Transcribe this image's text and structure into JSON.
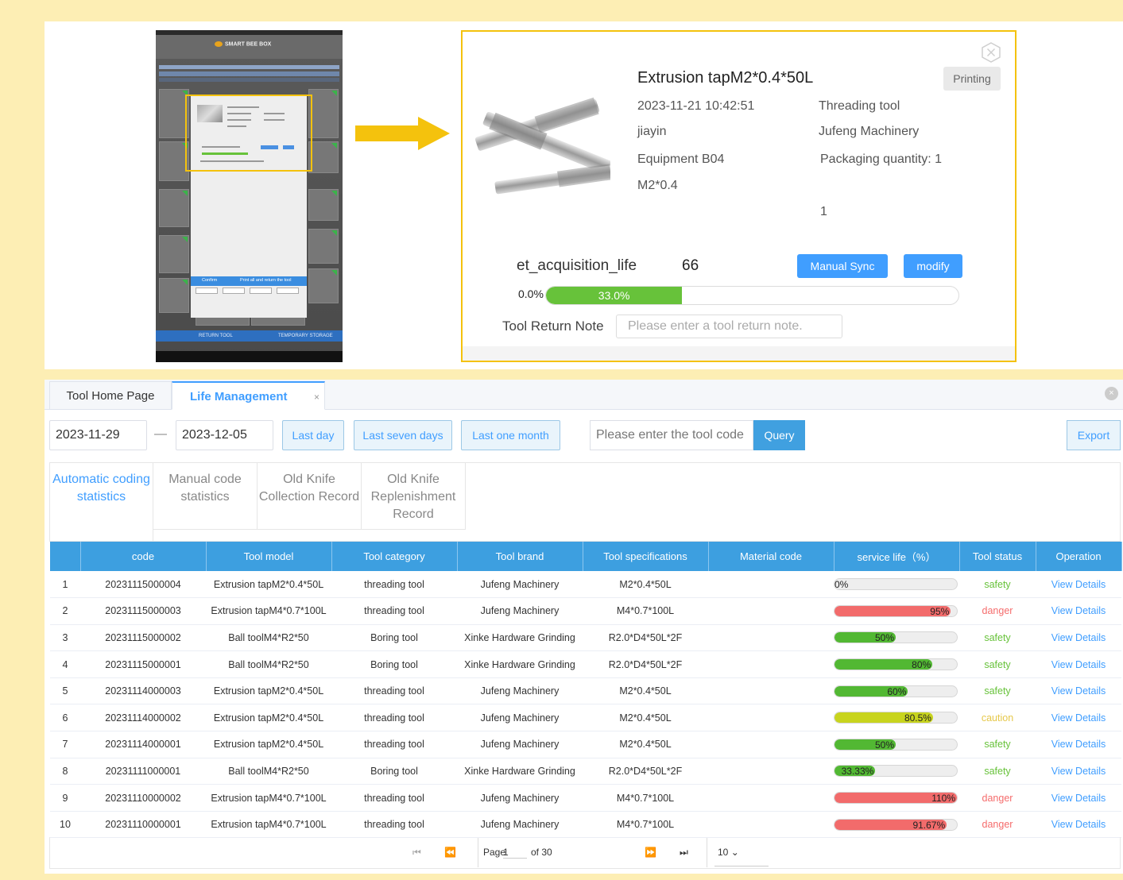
{
  "phone": {
    "logo": "SMART BEE BOX",
    "confirm": "Confirm",
    "print_all": "Print all and return the tool",
    "return_tool": "RETURN TOOL",
    "temporary_storage": "TEMPORARY STORAGE"
  },
  "detail": {
    "title": "Extrusion tapM2*0.4*50L",
    "printing": "Printing",
    "time": "2023-11-21 10:42:51",
    "category": "Threading tool",
    "user": "jiayin",
    "brand": "Jufeng Machinery",
    "equipment": "Equipment B04",
    "packaging": "Packaging quantity: 1",
    "spec": "M2*0.4",
    "count": "1",
    "life_label": "et_acquisition_life",
    "life_value": "66",
    "manual_sync": "Manual Sync",
    "modify": "modify",
    "bar_start": "0.0%",
    "progress_label": "33.0%",
    "progress": 33.0,
    "return_note_label": "Tool Return Note",
    "return_note_placeholder": "Please enter a tool return note."
  },
  "tabs": {
    "home": "Tool Home Page",
    "life": "Life Management",
    "close": "×"
  },
  "filters": {
    "start_date": "2023-11-29",
    "dash": "—",
    "end_date": "2023-12-05",
    "last_day": "Last day",
    "last_seven": "Last seven days",
    "last_month": "Last one month",
    "code_placeholder": "Please enter the tool code",
    "query": "Query",
    "export": "Export"
  },
  "subtabs": {
    "auto": "Automatic coding statistics",
    "manual": "Manual code statistics",
    "old_collection": "Old Knife Collection Record",
    "old_replenish": "Old Knife Replenishment Record"
  },
  "table": {
    "headers": [
      "",
      "code",
      "Tool model",
      "Tool category",
      "Tool brand",
      "Tool specifications",
      "Material code",
      "service life（%）",
      "Tool status",
      "Operation"
    ],
    "rows": [
      {
        "no": "1",
        "code": "20231115000004",
        "model": "Extrusion tapM2*0.4*50L",
        "category": "threading tool",
        "brand": "Jufeng Machinery",
        "spec": "M2*0.4*50L",
        "material": "",
        "life": 0,
        "life_label": "0%",
        "status": "safety",
        "op": "View Details"
      },
      {
        "no": "2",
        "code": "20231115000003",
        "model": "Extrusion tapM4*0.7*100L",
        "category": "threading tool",
        "brand": "Jufeng Machinery",
        "spec": "M4*0.7*100L",
        "material": "",
        "life": 95,
        "life_label": "95%",
        "status": "danger",
        "op": "View Details"
      },
      {
        "no": "3",
        "code": "20231115000002",
        "model": "Ball toolM4*R2*50",
        "category": "Boring tool",
        "brand": "Xinke Hardware Grinding",
        "spec": "R2.0*D4*50L*2F",
        "material": "",
        "life": 50,
        "life_label": "50%",
        "status": "safety",
        "op": "View Details"
      },
      {
        "no": "4",
        "code": "20231115000001",
        "model": "Ball toolM4*R2*50",
        "category": "Boring tool",
        "brand": "Xinke Hardware Grinding",
        "spec": "R2.0*D4*50L*2F",
        "material": "",
        "life": 80,
        "life_label": "80%",
        "status": "safety",
        "op": "View Details"
      },
      {
        "no": "5",
        "code": "20231114000003",
        "model": "Extrusion tapM2*0.4*50L",
        "category": "threading tool",
        "brand": "Jufeng Machinery",
        "spec": "M2*0.4*50L",
        "material": "",
        "life": 60,
        "life_label": "60%",
        "status": "safety",
        "op": "View Details"
      },
      {
        "no": "6",
        "code": "20231114000002",
        "model": "Extrusion tapM2*0.4*50L",
        "category": "threading tool",
        "brand": "Jufeng Machinery",
        "spec": "M2*0.4*50L",
        "material": "",
        "life": 80.5,
        "life_label": "80.5%",
        "status": "caution",
        "op": "View Details"
      },
      {
        "no": "7",
        "code": "20231114000001",
        "model": "Extrusion tapM2*0.4*50L",
        "category": "threading tool",
        "brand": "Jufeng Machinery",
        "spec": "M2*0.4*50L",
        "material": "",
        "life": 50,
        "life_label": "50%",
        "status": "safety",
        "op": "View Details"
      },
      {
        "no": "8",
        "code": "20231111000001",
        "model": "Ball toolM4*R2*50",
        "category": "Boring tool",
        "brand": "Xinke Hardware Grinding",
        "spec": "R2.0*D4*50L*2F",
        "material": "",
        "life": 33.33,
        "life_label": "33.33%",
        "status": "safety",
        "op": "View Details"
      },
      {
        "no": "9",
        "code": "20231110000002",
        "model": "Extrusion tapM4*0.7*100L",
        "category": "threading tool",
        "brand": "Jufeng Machinery",
        "spec": "M4*0.7*100L",
        "material": "",
        "life": 110,
        "life_label": "110%",
        "status": "danger",
        "op": "View Details"
      },
      {
        "no": "10",
        "code": "20231110000001",
        "model": "Extrusion tapM4*0.7*100L",
        "category": "threading tool",
        "brand": "Jufeng Machinery",
        "spec": "M4*0.7*100L",
        "material": "",
        "life": 91.67,
        "life_label": "91.67%",
        "status": "danger",
        "op": "View Details"
      }
    ]
  },
  "status_colors": {
    "safety": "#67c23a",
    "danger": "#f56c6c",
    "caution": "#e6c84a"
  },
  "bar_colors": {
    "safety": "#52b833",
    "danger": "#f26b6b",
    "caution": "#c8d41e"
  },
  "pager": {
    "page_label": "Page",
    "page": "1",
    "of": "of 30",
    "page_size": "10"
  }
}
